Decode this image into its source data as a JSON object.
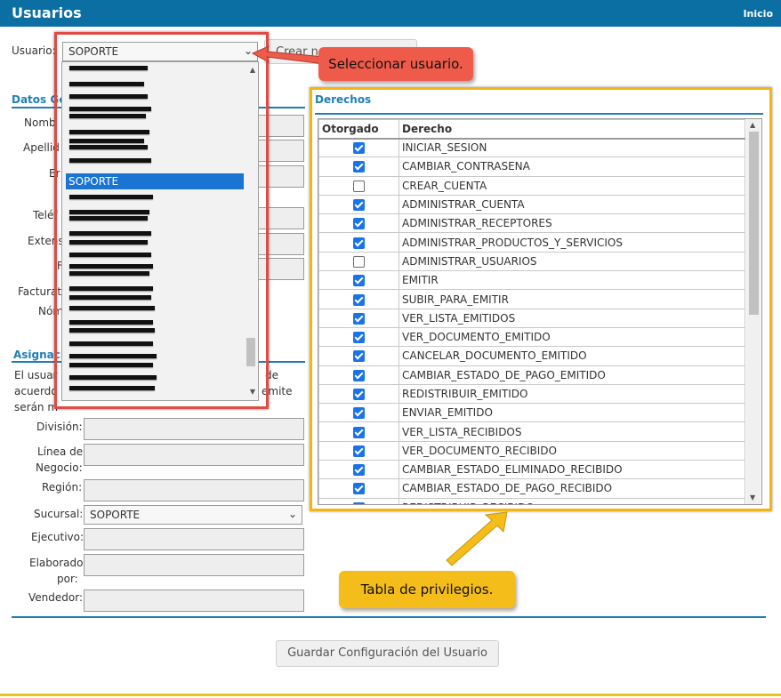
{
  "header": {
    "title": "Usuarios",
    "home_link": "Inicio"
  },
  "user_label": "Usuario:",
  "user_select_value": "SOPORTE",
  "create_button": "Crear n",
  "dropdown": {
    "selected_item": "SOPORTE"
  },
  "datos_generales": {
    "title": "Datos Ge",
    "labels": [
      "Nomb",
      "Apellid",
      "Er",
      "Teléf",
      "Extens",
      "F",
      "Facturat",
      "Nómi"
    ]
  },
  "asignacion": {
    "title": "Asignaci",
    "desc_1": "El usuar",
    "desc_1b": "de",
    "desc_2": "acuerdo",
    "desc_2b": "emite",
    "desc_3": "serán m",
    "fields": {
      "division": "División:",
      "linea_1": "Línea de",
      "linea_2": "Negocio:",
      "region": "Región:",
      "sucursal": "Sucursal:",
      "ejecutivo": "Ejecutivo:",
      "elaborado_1": "Elaborado",
      "elaborado_2": "por:",
      "vendedor": "Vendedor:"
    },
    "sucursal_value": "SOPORTE"
  },
  "derechos": {
    "title": "Derechos",
    "headers": [
      "Otorgado",
      "Derecho"
    ],
    "rows": [
      {
        "checked": true,
        "name": "INICIAR_SESION"
      },
      {
        "checked": true,
        "name": "CAMBIAR_CONTRASENA"
      },
      {
        "checked": false,
        "name": "CREAR_CUENTA"
      },
      {
        "checked": true,
        "name": "ADMINISTRAR_CUENTA"
      },
      {
        "checked": true,
        "name": "ADMINISTRAR_RECEPTORES"
      },
      {
        "checked": true,
        "name": "ADMINISTRAR_PRODUCTOS_Y_SERVICIOS"
      },
      {
        "checked": false,
        "name": "ADMINISTRAR_USUARIOS"
      },
      {
        "checked": true,
        "name": "EMITIR"
      },
      {
        "checked": true,
        "name": "SUBIR_PARA_EMITIR"
      },
      {
        "checked": true,
        "name": "VER_LISTA_EMITIDOS"
      },
      {
        "checked": true,
        "name": "VER_DOCUMENTO_EMITIDO"
      },
      {
        "checked": true,
        "name": "CANCELAR_DOCUMENTO_EMITIDO"
      },
      {
        "checked": true,
        "name": "CAMBIAR_ESTADO_DE_PAGO_EMITIDO"
      },
      {
        "checked": true,
        "name": "REDISTRIBUIR_EMITIDO"
      },
      {
        "checked": true,
        "name": "ENVIAR_EMITIDO"
      },
      {
        "checked": true,
        "name": "VER_LISTA_RECIBIDOS"
      },
      {
        "checked": true,
        "name": "VER_DOCUMENTO_RECIBIDO"
      },
      {
        "checked": true,
        "name": "CAMBIAR_ESTADO_ELIMINADO_RECIBIDO"
      },
      {
        "checked": true,
        "name": "CAMBIAR_ESTADO_DE_PAGO_RECIBIDO"
      },
      {
        "checked": true,
        "name": "REDISTRIBUIR_RECIBIDO"
      }
    ]
  },
  "callouts": {
    "select_user": "Seleccionar usuario.",
    "privileges_table": "Tabla de privilegios."
  },
  "save_button": "Guardar Configuración del Usuario",
  "colors": {
    "header_blue": "#0b6fa4",
    "callout_red": "#ef5b4b",
    "callout_yellow": "#f5bd19",
    "checkbox_blue": "#1a73e8"
  }
}
